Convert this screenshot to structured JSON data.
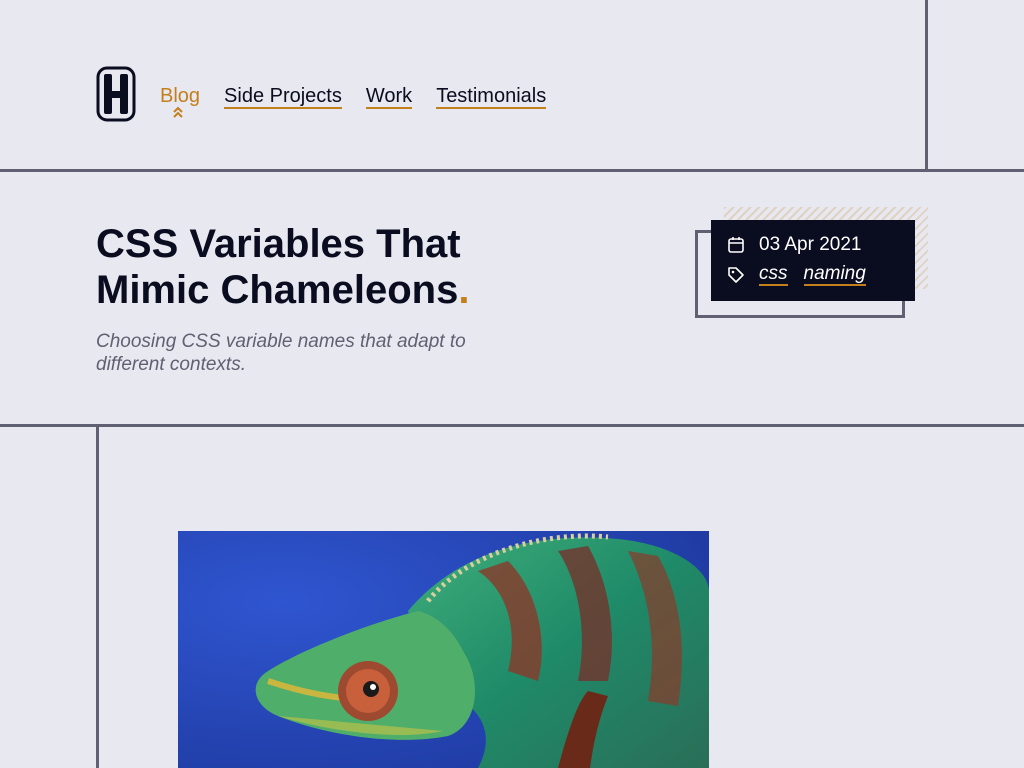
{
  "nav": {
    "items": [
      {
        "label": "Blog",
        "active": true
      },
      {
        "label": "Side Projects",
        "active": false
      },
      {
        "label": "Work",
        "active": false
      },
      {
        "label": "Testimonials",
        "active": false
      }
    ]
  },
  "article": {
    "title_line1": "CSS Variables That",
    "title_line2": "Mimic Chameleons",
    "title_dot": ".",
    "subtitle": "Choosing CSS variable names that adapt to different contexts.",
    "date": "03 Apr 2021",
    "tags": [
      "css",
      "naming"
    ]
  },
  "colors": {
    "background": "#e8e8f0",
    "ink": "#0a0c1f",
    "accent": "#c47f1d",
    "muted": "#5f6072"
  },
  "icons": {
    "logo": "h-logo-icon",
    "active_nav": "double-chevron-up-icon",
    "date": "calendar-icon",
    "tags": "tag-icon"
  },
  "hero": {
    "description_alt": "chameleon"
  }
}
